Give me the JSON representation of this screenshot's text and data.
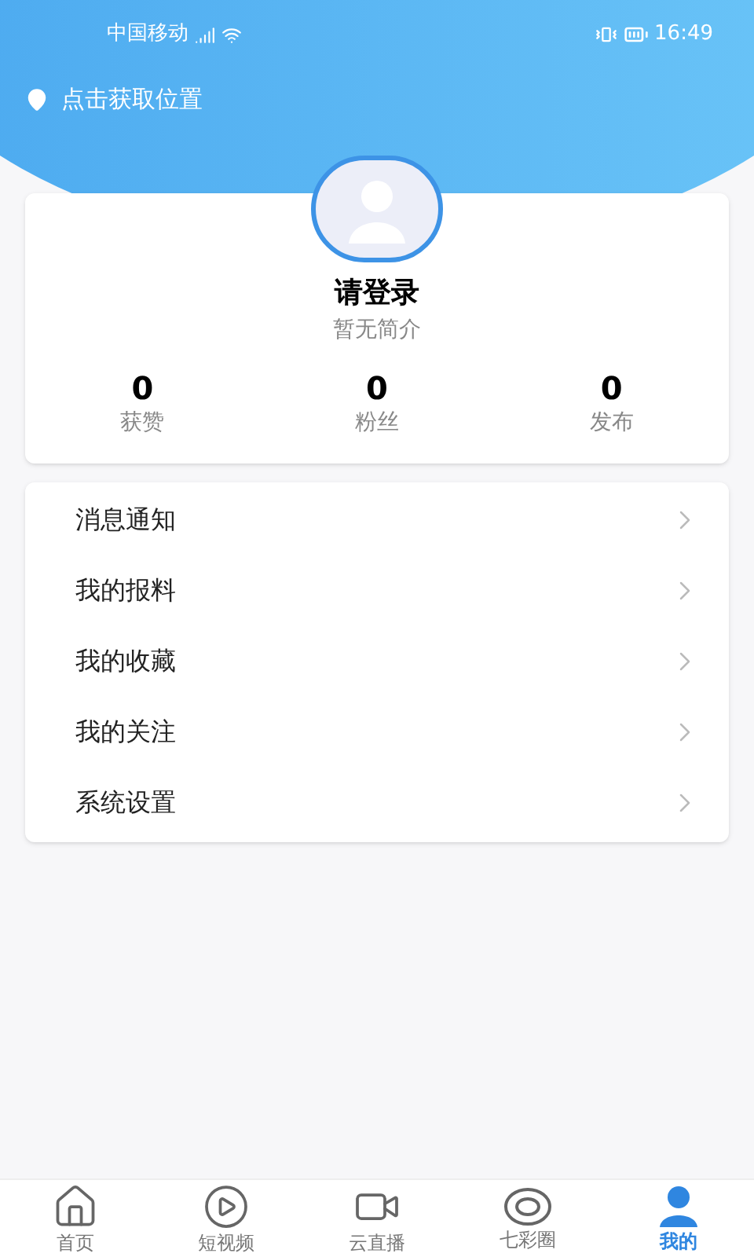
{
  "status_bar": {
    "carrier": "中国移动",
    "time": "16:49"
  },
  "location": {
    "label": "点击获取位置"
  },
  "profile": {
    "name": "请登录",
    "bio": "暂无简介",
    "stats": [
      {
        "value": "0",
        "label": "获赞"
      },
      {
        "value": "0",
        "label": "粉丝"
      },
      {
        "value": "0",
        "label": "发布"
      }
    ]
  },
  "menu": [
    {
      "label": "消息通知"
    },
    {
      "label": "我的报料"
    },
    {
      "label": "我的收藏"
    },
    {
      "label": "我的关注"
    },
    {
      "label": "系统设置"
    }
  ],
  "tabs": [
    {
      "kind": "home",
      "label": "首页",
      "selected": false
    },
    {
      "kind": "play",
      "label": "短视频",
      "selected": false
    },
    {
      "kind": "video",
      "label": "云直播",
      "selected": false
    },
    {
      "kind": "eye",
      "label": "七彩圈",
      "selected": false
    },
    {
      "kind": "user",
      "label": "我的",
      "selected": true
    }
  ]
}
